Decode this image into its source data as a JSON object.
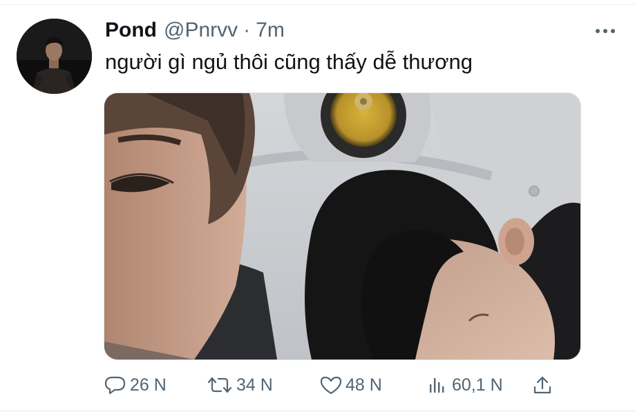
{
  "tweet": {
    "author_name": "Pond",
    "handle": "@Pnrvv",
    "separator": "·",
    "time": "7m",
    "text": "người gì ngủ thôi cũng thấy dễ thương"
  },
  "actions": {
    "replies": "26 N",
    "retweets": "34 N",
    "likes": "48 N",
    "views": "60,1 N"
  },
  "icons": {
    "more": "more-horizontal-icon",
    "reply": "speech-bubble-icon",
    "retweet": "retweet-arrows-icon",
    "like": "heart-outline-icon",
    "views": "bar-chart-icon",
    "share": "share-upload-icon"
  },
  "colors": {
    "text_primary": "#0f1419",
    "text_secondary": "#536471",
    "divider": "#eceef0"
  }
}
